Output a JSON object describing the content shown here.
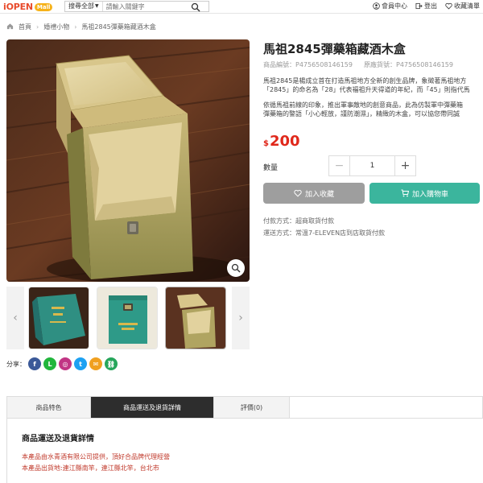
{
  "header": {
    "logo": "iOPEN",
    "logo_badge": "Mall",
    "search_scope": "搜尋全部",
    "search_placeholder": "請輸入關鍵字",
    "links": [
      "會員中心",
      "登出",
      "收藏清單"
    ]
  },
  "breadcrumb": [
    "首頁",
    "婚禮小物",
    "馬祖2845彈藥箱藏酒木盒"
  ],
  "product": {
    "title": "馬祖2845彈藥箱藏酒木盒",
    "code_label": "商品編號：P4756508146159",
    "seller_code_label": "原廠貨號：P4756508146159",
    "desc_p1_l1": "馬祖2845是楊成立首在打造馬祖地方全新的創生品牌，象徵著馬祖地方",
    "desc_p1_l2": "「2845」的命名為「28」代表福祖升天得道的年紀，而「45」則指代馬",
    "desc_p2_l1": "依循馬祖前線的印象，推出軍事敵地的創意商品，此為仿製軍中彈藥箱",
    "desc_p2_l2": "彈藥箱的警語「小心輕放，謹防潮濕」，精緻的木盒，可以協您帶同誠",
    "currency": "$",
    "price": "200",
    "qty_label": "數量",
    "qty_value": "1",
    "fav_label": "加入收藏",
    "cart_label": "加入購物車",
    "pay_line": "付款方式：超商取貨付款",
    "ship_line": "運送方式：常溫7-ELEVEN店到店取貨付款"
  },
  "share_label": "分享：",
  "share_icons": [
    "facebook-icon",
    "line-icon",
    "instagram-icon",
    "twitter-icon",
    "email-icon",
    "link-icon"
  ],
  "tabs": [
    "商品特色",
    "商品運送及退貨詳情",
    "評價(0)"
  ],
  "content": {
    "title": "商品運送及退貨詳情",
    "line1": "本產品由水青酒有限公司提供，頂好合品牌代理經營",
    "line2": "本產品出貨地:連江縣南竿，連江縣北竿，台北市"
  },
  "colors": {
    "price": "#e0281b",
    "cart_button": "#3bb59d",
    "fav_button": "#9e9e9e",
    "active_tab": "#2d2d2d"
  }
}
